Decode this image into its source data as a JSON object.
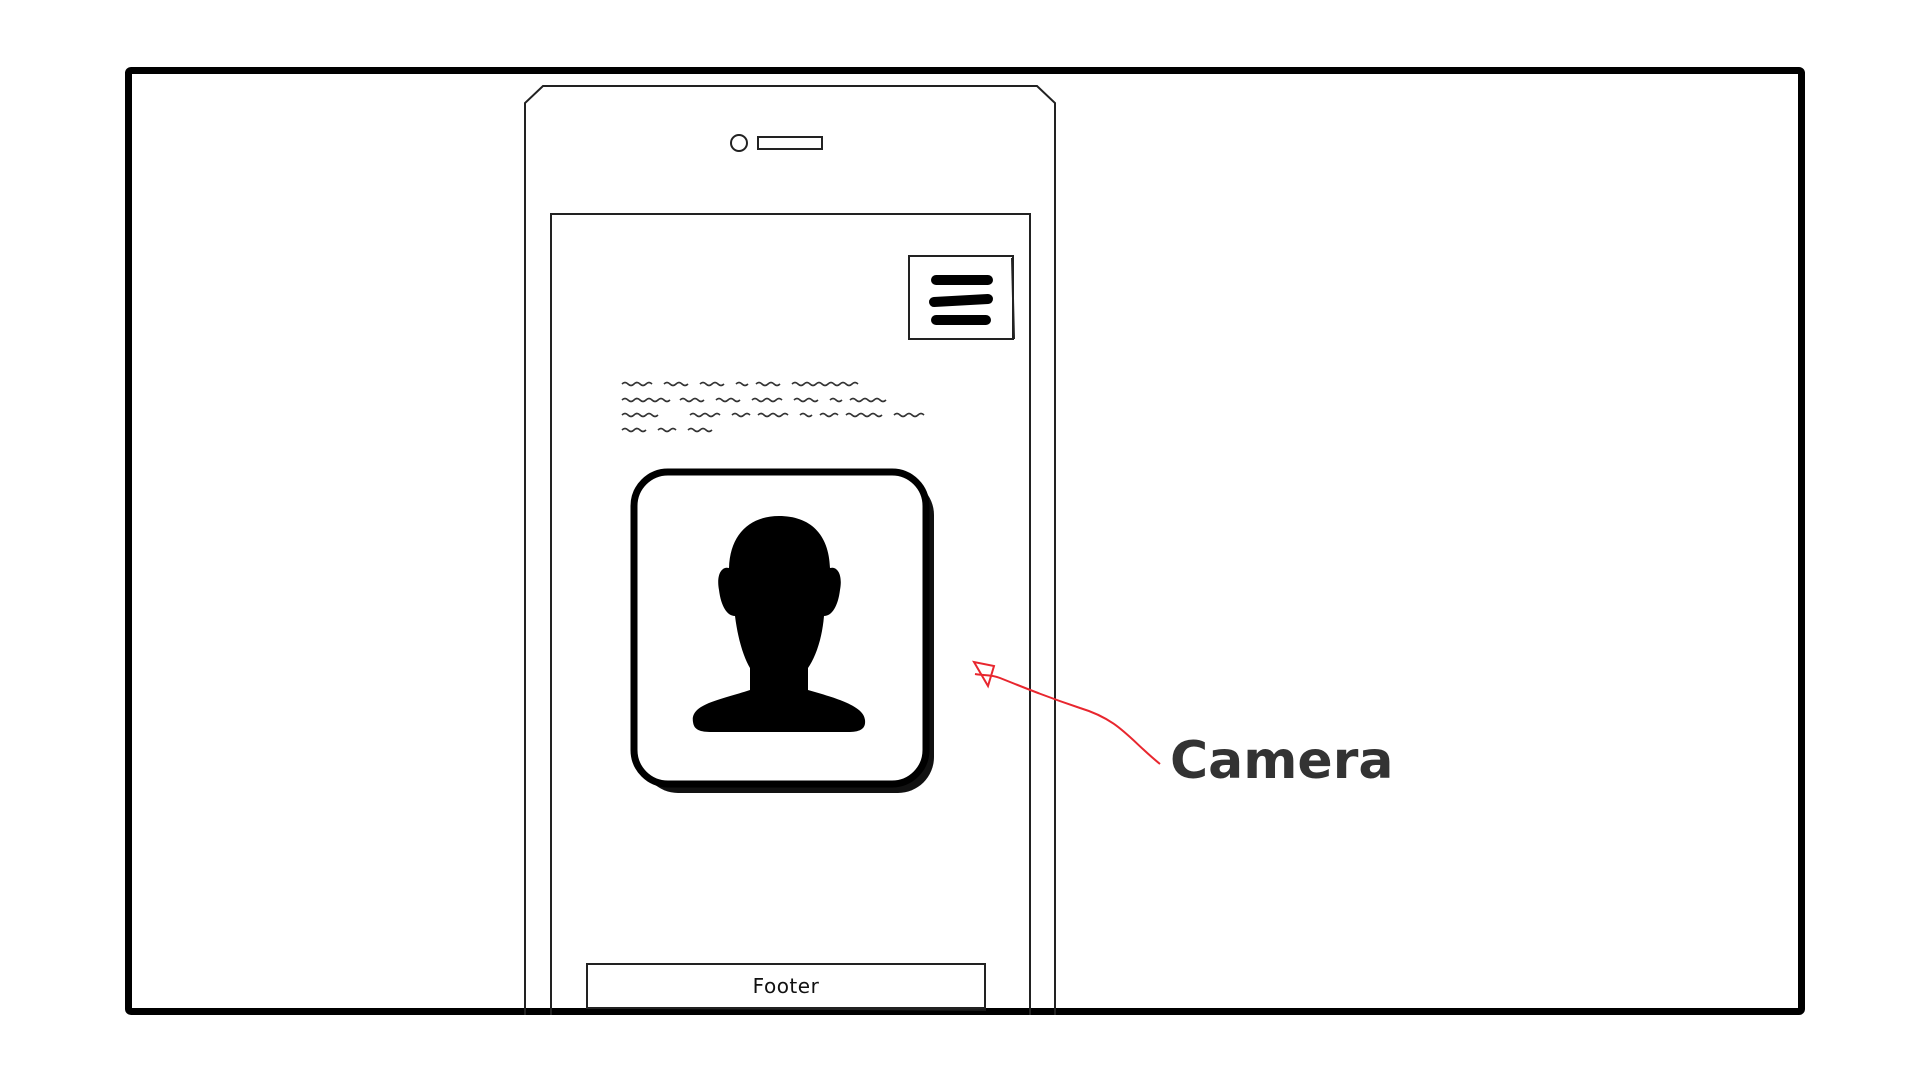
{
  "annotation": {
    "label": "Camera",
    "arrow_color": "#e8262e"
  },
  "phone": {
    "footer_label": "Footer",
    "menu_icon": "hamburger-icon",
    "avatar_icon": "person-silhouette-icon"
  },
  "colors": {
    "frame": "#000000",
    "sketch_line": "#222222",
    "annotation_text": "#333333"
  }
}
